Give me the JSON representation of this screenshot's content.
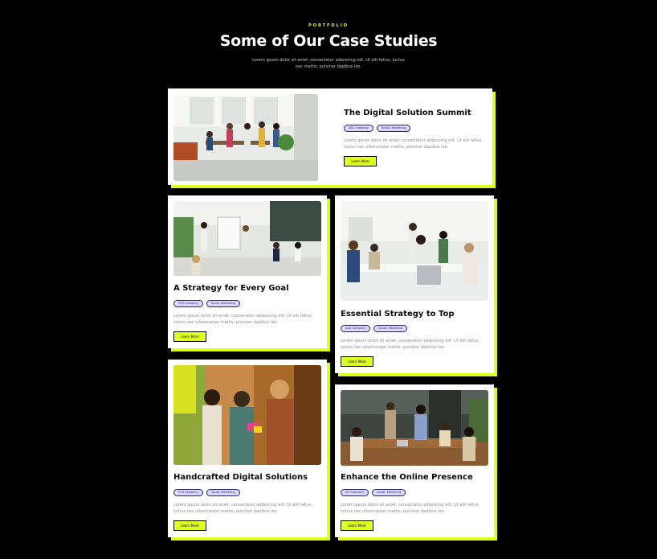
{
  "header": {
    "eyebrow": "PORTFOLIO",
    "title": "Some of Our Case Studies",
    "subtitle": "Lorem ipsum dolor sit amet, consectetur adipiscing elit. Ut elit tellus, luctus nec mattis, pulvinar dapibus leo."
  },
  "cards": [
    {
      "title": "The Digital Solution Summit",
      "tags": [
        "ABC Company",
        "Social, Marketing"
      ],
      "description": "Lorem ipsum dolor sit amet, consectetur adipiscing elit. Ut elit tellus, luctus nec ullamcorper mattis, pulvinar dapibus leo.",
      "button": "Learn More"
    },
    {
      "title": "A Strategy for Every Goal",
      "tags": [
        "YOS Company",
        "Social, Marketing"
      ],
      "description": "Lorem ipsum dolor sit amet, consectetur adipiscing elit. Ut elit tellus, luctus nec ullamcorper mattis, pulvinar dapibus leo.",
      "button": "Learn More"
    },
    {
      "title": "Essential Strategy to Top",
      "tags": [
        "AAA Company",
        "Social, Marketing"
      ],
      "description": "Lorem ipsum dolor sit amet, consectetur adipiscing elit. Ut elit tellus, luctus nec ullamcorper mattis, pulvinar dapibus leo.",
      "button": "Learn More"
    },
    {
      "title": "Handcrafted Digital Solutions",
      "tags": [
        "YOS Company",
        "Social, Marketing"
      ],
      "description": "Lorem ipsum dolor sit amet, consectetur adipiscing elit. Ut elit tellus, luctus nec ullamcorper mattis, pulvinar dapibus leo.",
      "button": "Learn More"
    },
    {
      "title": "Enhance the Online Presence",
      "tags": [
        "SIT Company",
        "Social, Marketing"
      ],
      "description": "Lorem ipsum dolor sit amet, consectetur adipiscing elit. Ut elit tellus, luctus nec ullamcorper mattis, pulvinar dapibus leo.",
      "button": "Learn More"
    }
  ],
  "colors": {
    "background": "#000000",
    "accent": "#dfff1f",
    "tag_fill": "#ddd9ff",
    "tag_border": "#2a2370"
  }
}
